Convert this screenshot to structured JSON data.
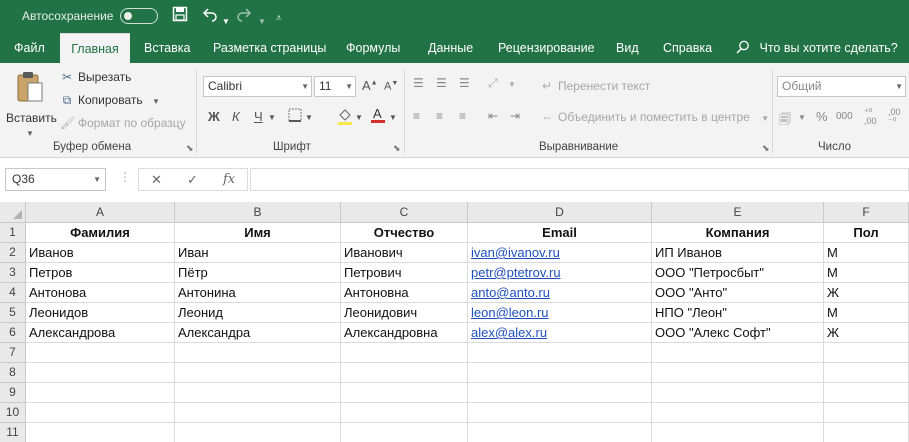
{
  "titlebar": {
    "autosave_label": "Автосохранение",
    "save_icon": "save-icon",
    "undo_icon": "undo-icon",
    "redo_icon": "redo-icon",
    "customize_icon": "customize-qat-icon",
    "accent": "#217346"
  },
  "tabs": [
    "Файл",
    "Главная",
    "Вставка",
    "Разметка страницы",
    "Формулы",
    "Данные",
    "Рецензирование",
    "Вид",
    "Справка"
  ],
  "search": {
    "label": "Что вы хотите сделать?"
  },
  "ribbon": {
    "clipboard": {
      "paste": "Вставить",
      "cut": "Вырезать",
      "copy": "Копировать",
      "format_painter": "Формат по образцу",
      "group_label": "Буфер обмена"
    },
    "font": {
      "font_name": "Calibri",
      "font_size": "11",
      "bold": "Ж",
      "italic": "К",
      "underline": "Ч",
      "group_label": "Шрифт"
    },
    "alignment": {
      "wrap_text": "Перенести текст",
      "merge_center": "Объединить и поместить в центре",
      "group_label": "Выравнивание"
    },
    "number": {
      "format": "Общий",
      "group_label": "Число"
    }
  },
  "formula_bar": {
    "name_box": "Q36",
    "fx": "fx",
    "formula": ""
  },
  "sheet": {
    "columns": [
      "A",
      "B",
      "C",
      "D",
      "E",
      "F"
    ],
    "rows": [
      [
        "Фамилия",
        "Имя",
        "Отчество",
        "Email",
        "Компания",
        "Пол"
      ],
      [
        "Иванов",
        "Иван",
        "Иванович",
        "ivan@ivanov.ru",
        "ИП Иванов",
        "М"
      ],
      [
        "Петров",
        "Пётр",
        "Петрович",
        "petr@ptetrov.ru",
        "ООО \"Петросбыт\"",
        "М"
      ],
      [
        "Антонова",
        "Антонина",
        "Антоновна",
        "anto@anto.ru",
        "ООО \"Анто\"",
        "Ж"
      ],
      [
        "Леонидов",
        "Леонид",
        "Леонидович",
        "leon@leon.ru",
        "НПО \"Леон\"",
        "М"
      ],
      [
        "Александрова",
        "Александра",
        "Александровна",
        "alex@alex.ru",
        "ООО \"Алекс Софт\"",
        "Ж"
      ],
      [
        "",
        "",
        "",
        "",
        "",
        ""
      ],
      [
        "",
        "",
        "",
        "",
        "",
        ""
      ],
      [
        "",
        "",
        "",
        "",
        "",
        ""
      ],
      [
        "",
        "",
        "",
        "",
        "",
        ""
      ],
      [
        "",
        "",
        "",
        "",
        "",
        ""
      ]
    ],
    "row_numbers": [
      "1",
      "2",
      "3",
      "4",
      "5",
      "6",
      "7",
      "8",
      "9",
      "10",
      "11"
    ]
  }
}
